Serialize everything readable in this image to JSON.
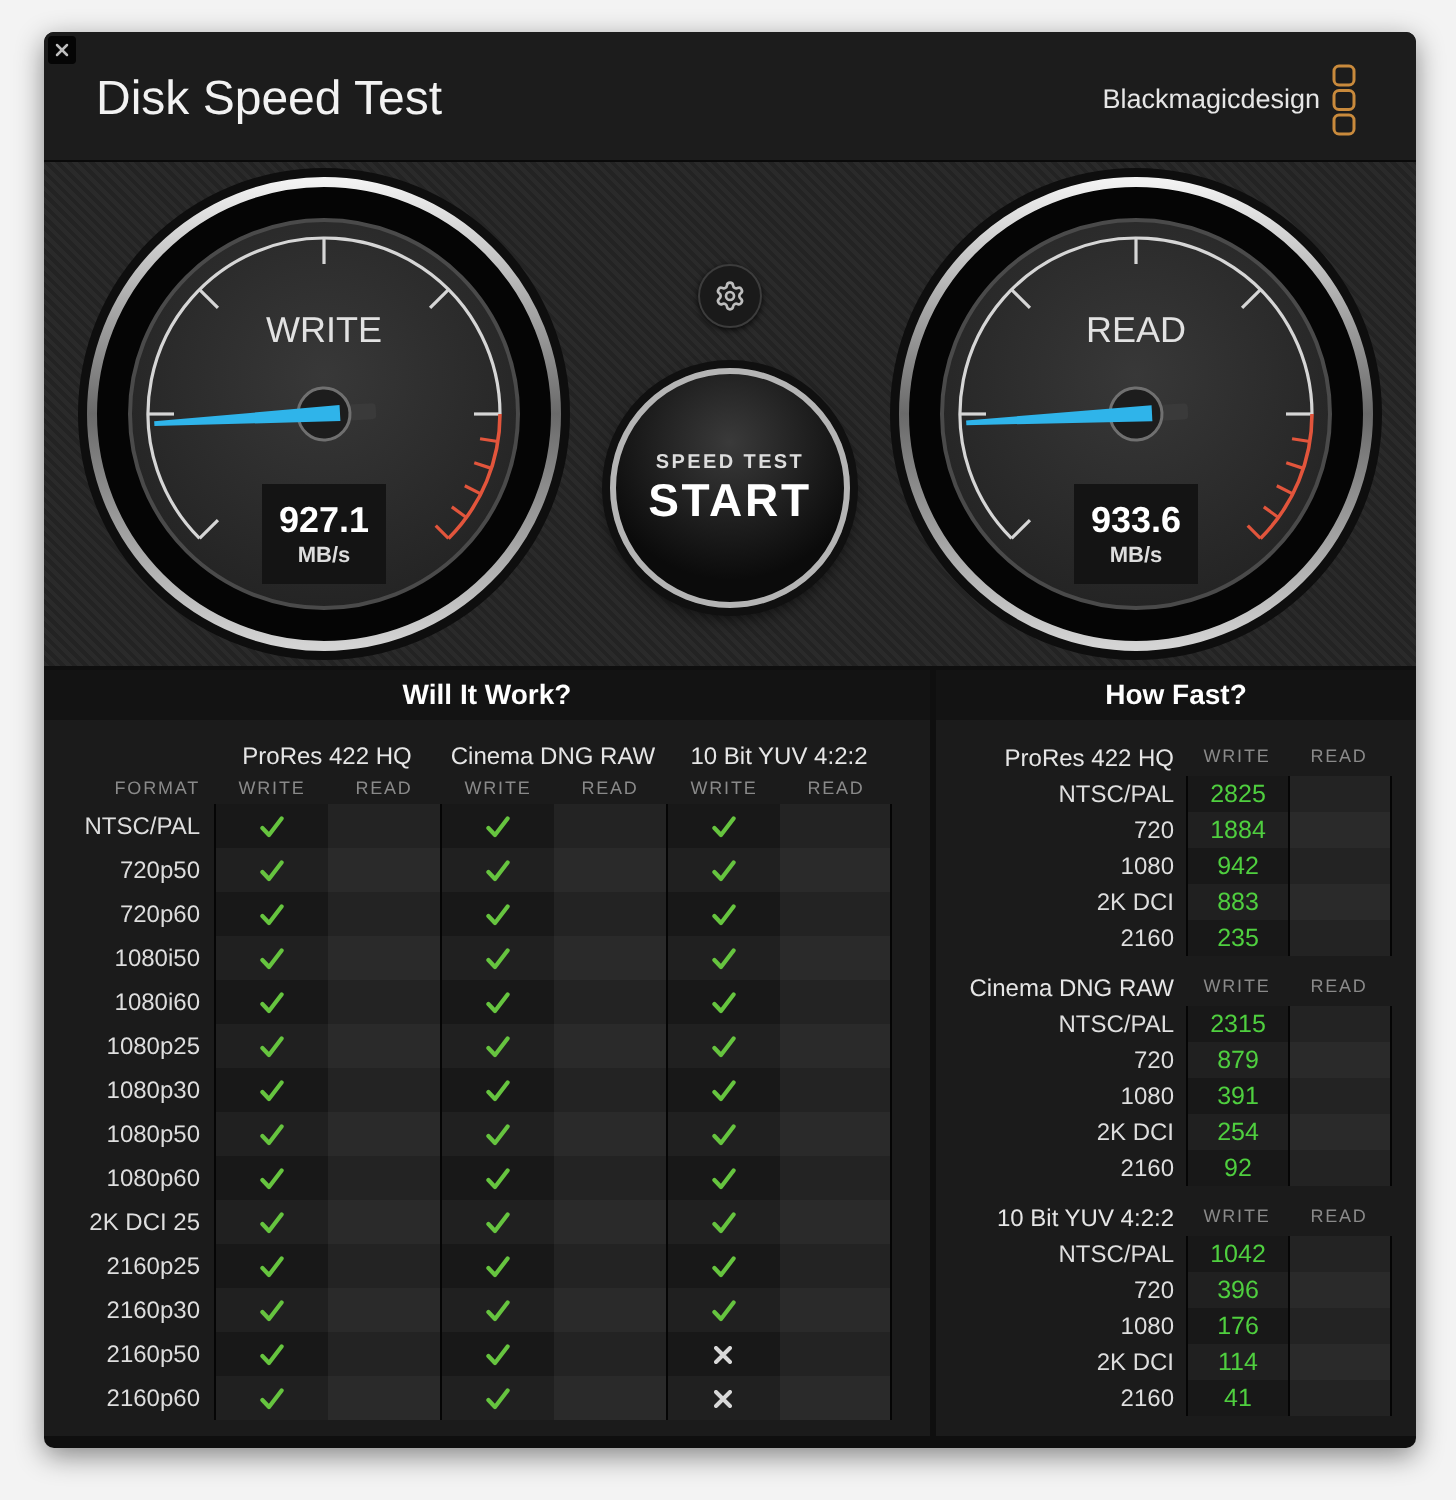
{
  "window": {
    "title": "Disk Speed Test",
    "brand": "Blackmagicdesign"
  },
  "gauges": [
    {
      "label": "WRITE",
      "value": "927.1",
      "unit": "MB/s"
    },
    {
      "label": "READ",
      "value": "933.6",
      "unit": "MB/s"
    }
  ],
  "start_button": {
    "caption": "SPEED TEST",
    "label": "START"
  },
  "will_it_work": {
    "title": "Will It Work?",
    "format_header": "FORMAT",
    "groups": [
      {
        "name": "ProRes 422 HQ",
        "write_header": "WRITE",
        "read_header": "READ"
      },
      {
        "name": "Cinema DNG RAW",
        "write_header": "WRITE",
        "read_header": "READ"
      },
      {
        "name": "10 Bit YUV 4:2:2",
        "write_header": "WRITE",
        "read_header": "READ"
      }
    ],
    "rows": [
      {
        "format": "NTSC/PAL",
        "write_ok": [
          true,
          true,
          true
        ]
      },
      {
        "format": "720p50",
        "write_ok": [
          true,
          true,
          true
        ]
      },
      {
        "format": "720p60",
        "write_ok": [
          true,
          true,
          true
        ]
      },
      {
        "format": "1080i50",
        "write_ok": [
          true,
          true,
          true
        ]
      },
      {
        "format": "1080i60",
        "write_ok": [
          true,
          true,
          true
        ]
      },
      {
        "format": "1080p25",
        "write_ok": [
          true,
          true,
          true
        ]
      },
      {
        "format": "1080p30",
        "write_ok": [
          true,
          true,
          true
        ]
      },
      {
        "format": "1080p50",
        "write_ok": [
          true,
          true,
          true
        ]
      },
      {
        "format": "1080p60",
        "write_ok": [
          true,
          true,
          true
        ]
      },
      {
        "format": "2K DCI 25",
        "write_ok": [
          true,
          true,
          true
        ]
      },
      {
        "format": "2160p25",
        "write_ok": [
          true,
          true,
          true
        ]
      },
      {
        "format": "2160p30",
        "write_ok": [
          true,
          true,
          true
        ]
      },
      {
        "format": "2160p50",
        "write_ok": [
          true,
          true,
          false
        ]
      },
      {
        "format": "2160p60",
        "write_ok": [
          true,
          true,
          false
        ]
      }
    ]
  },
  "how_fast": {
    "title": "How Fast?",
    "groups": [
      {
        "name": "ProRes 422 HQ",
        "write_header": "WRITE",
        "read_header": "READ",
        "rows": [
          {
            "format": "NTSC/PAL",
            "write": "2825"
          },
          {
            "format": "720",
            "write": "1884"
          },
          {
            "format": "1080",
            "write": "942"
          },
          {
            "format": "2K DCI",
            "write": "883"
          },
          {
            "format": "2160",
            "write": "235"
          }
        ]
      },
      {
        "name": "Cinema DNG RAW",
        "write_header": "WRITE",
        "read_header": "READ",
        "rows": [
          {
            "format": "NTSC/PAL",
            "write": "2315"
          },
          {
            "format": "720",
            "write": "879"
          },
          {
            "format": "1080",
            "write": "391"
          },
          {
            "format": "2K DCI",
            "write": "254"
          },
          {
            "format": "2160",
            "write": "92"
          }
        ]
      },
      {
        "name": "10 Bit YUV 4:2:2",
        "write_header": "WRITE",
        "read_header": "READ",
        "rows": [
          {
            "format": "NTSC/PAL",
            "write": "1042"
          },
          {
            "format": "720",
            "write": "396"
          },
          {
            "format": "1080",
            "write": "176"
          },
          {
            "format": "2K DCI",
            "write": "114"
          },
          {
            "format": "2160",
            "write": "41"
          }
        ]
      }
    ]
  }
}
